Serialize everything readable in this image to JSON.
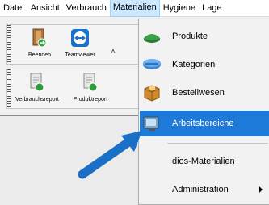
{
  "menubar": {
    "items": [
      "Datei",
      "Ansicht",
      "Verbrauch",
      "Materialien",
      "Hygiene",
      "Lage"
    ],
    "active_index": 3
  },
  "toolbar1": {
    "buttons": [
      {
        "label": "Beenden",
        "icon": "exit-door-icon"
      },
      {
        "label": "Teamviewer",
        "icon": "teamviewer-icon"
      },
      {
        "label": "A",
        "icon": "truncated-icon"
      }
    ]
  },
  "toolbar2": {
    "buttons": [
      {
        "label": "Verbrauchsreport",
        "icon": "report-icon"
      },
      {
        "label": "Produktreport",
        "icon": "report-icon"
      }
    ]
  },
  "dropdown": {
    "items": [
      {
        "label": "Produkte",
        "icon": "products-icon"
      },
      {
        "label": "Kategorien",
        "icon": "categories-icon"
      },
      {
        "label": "Bestellwesen",
        "icon": "order-box-icon"
      },
      {
        "label": "Arbeitsbereiche",
        "icon": "workspace-icon",
        "highlighted": true
      },
      {
        "label": "dios-Materialien",
        "icon": ""
      },
      {
        "label": "Administration",
        "icon": "",
        "has_submenu": true
      }
    ]
  },
  "colors": {
    "highlight": "#1e7ad8",
    "arrow": "#1a6fc7",
    "menu_active": "#cce8ff"
  }
}
